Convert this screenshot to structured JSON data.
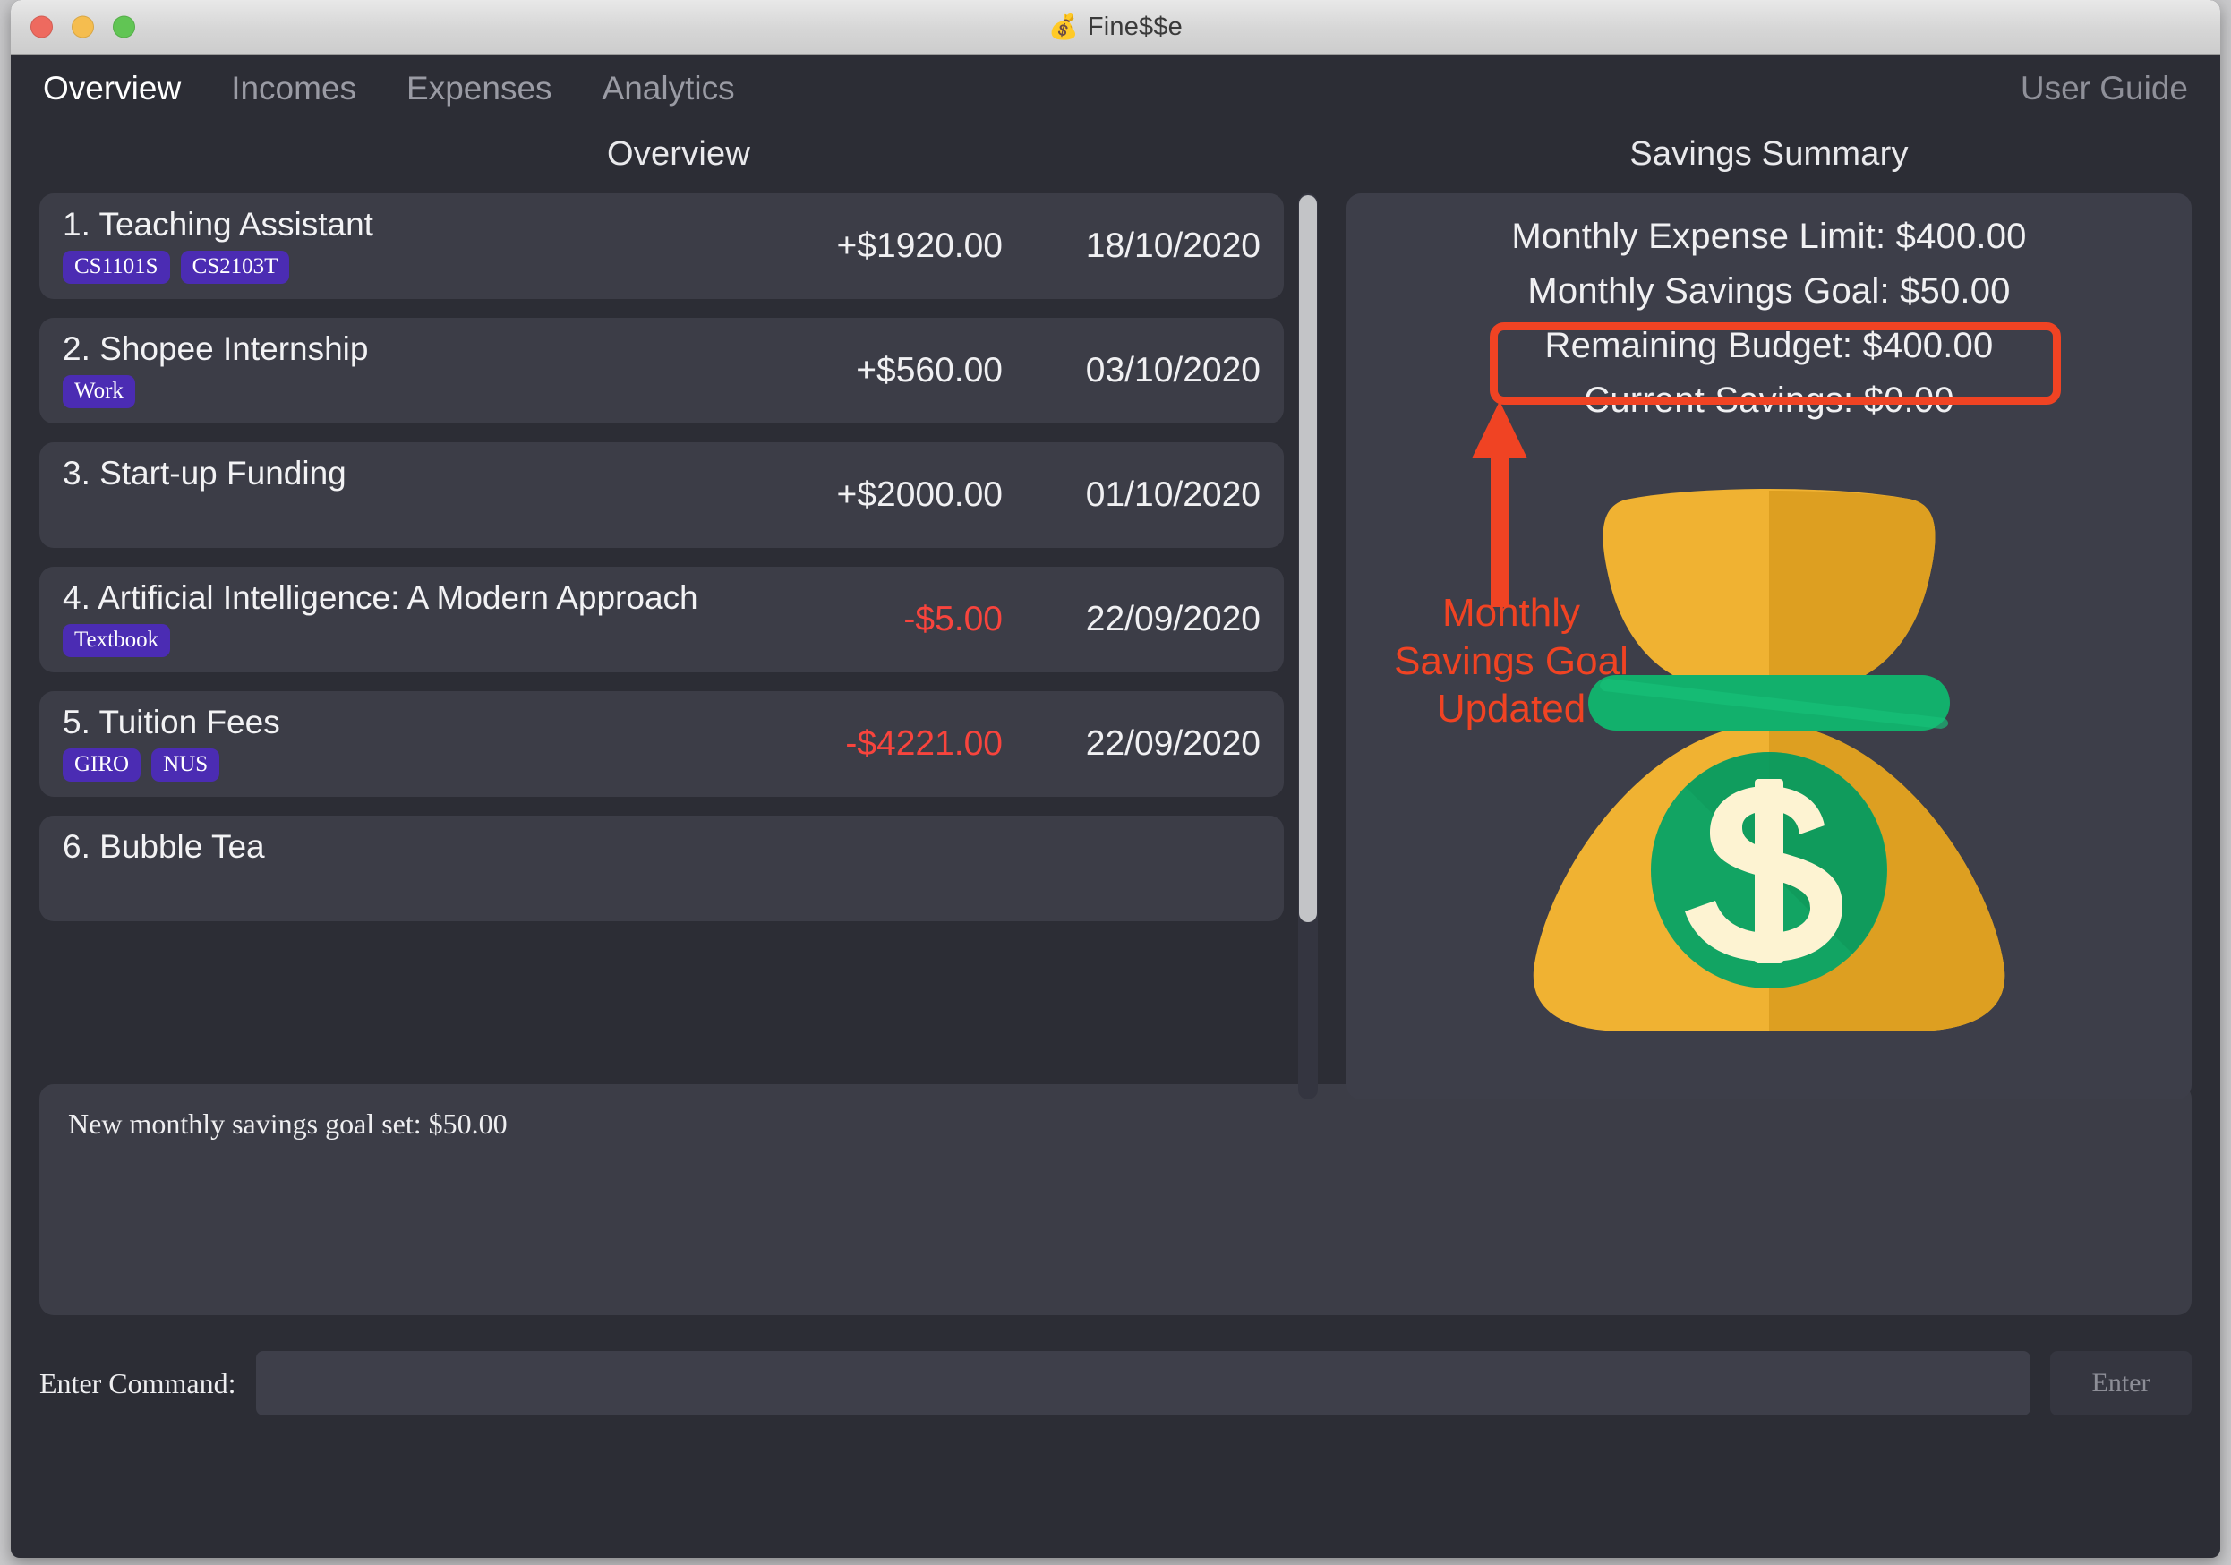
{
  "window": {
    "title": "Fine$$e",
    "title_icon": "money-bag-icon",
    "traffic_lights": [
      "close",
      "minimize",
      "maximize"
    ]
  },
  "tabs": [
    {
      "label": "Overview",
      "active": true
    },
    {
      "label": "Incomes",
      "active": false
    },
    {
      "label": "Expenses",
      "active": false
    },
    {
      "label": "Analytics",
      "active": false
    }
  ],
  "user_guide_label": "User Guide",
  "overview": {
    "panel_title": "Overview",
    "transactions": [
      {
        "index": "1.",
        "name": "Teaching Assistant",
        "tags": [
          "CS1101S",
          "CS2103T"
        ],
        "amount": "+$1920.00",
        "sign": "pos",
        "date": "18/10/2020"
      },
      {
        "index": "2.",
        "name": "Shopee Internship",
        "tags": [
          "Work"
        ],
        "amount": "+$560.00",
        "sign": "pos",
        "date": "03/10/2020"
      },
      {
        "index": "3.",
        "name": "Start-up Funding",
        "tags": [],
        "amount": "+$2000.00",
        "sign": "pos",
        "date": "01/10/2020"
      },
      {
        "index": "4.",
        "name": "Artificial Intelligence: A Modern Approach",
        "tags": [
          "Textbook"
        ],
        "amount": "-$5.00",
        "sign": "neg",
        "date": "22/09/2020"
      },
      {
        "index": "5.",
        "name": "Tuition Fees",
        "tags": [
          "GIRO",
          "NUS"
        ],
        "amount": "-$4221.00",
        "sign": "neg",
        "date": "22/09/2020"
      },
      {
        "index": "6.",
        "name": "Bubble Tea",
        "tags": [],
        "amount": "",
        "sign": "pos",
        "date": ""
      }
    ]
  },
  "savings": {
    "panel_title": "Savings Summary",
    "lines": [
      "Monthly Expense Limit: $400.00",
      "Monthly Savings Goal: $50.00",
      "Remaining Budget: $400.00",
      "Current Savings: $0.00"
    ],
    "illustration": "money-bag-illustration"
  },
  "annotation": {
    "text": "Monthly\nSavings Goal\nUpdated",
    "line1": "Monthly",
    "line2": "Savings Goal",
    "line3": "Updated",
    "color": "#f04323",
    "highlight_target": "Monthly Savings Goal: $50.00"
  },
  "result": {
    "text": "New monthly savings goal set: $50.00"
  },
  "command": {
    "label": "Enter Command:",
    "value": "",
    "placeholder": "",
    "button_label": "Enter"
  },
  "colors": {
    "window_bg": "#2c2d35",
    "card_bg": "#3c3d47",
    "panel_bg": "#3d3e49",
    "tag_purple": "#4b2cb3",
    "negative_red": "#f8443d",
    "annotation_red": "#f04323",
    "bag_light": "#f0b232",
    "bag_dark": "#dd9f21",
    "ribbon_green": "#12b06c",
    "coin_green": "#12a463",
    "scrollbar_thumb": "#c3c4c7"
  }
}
